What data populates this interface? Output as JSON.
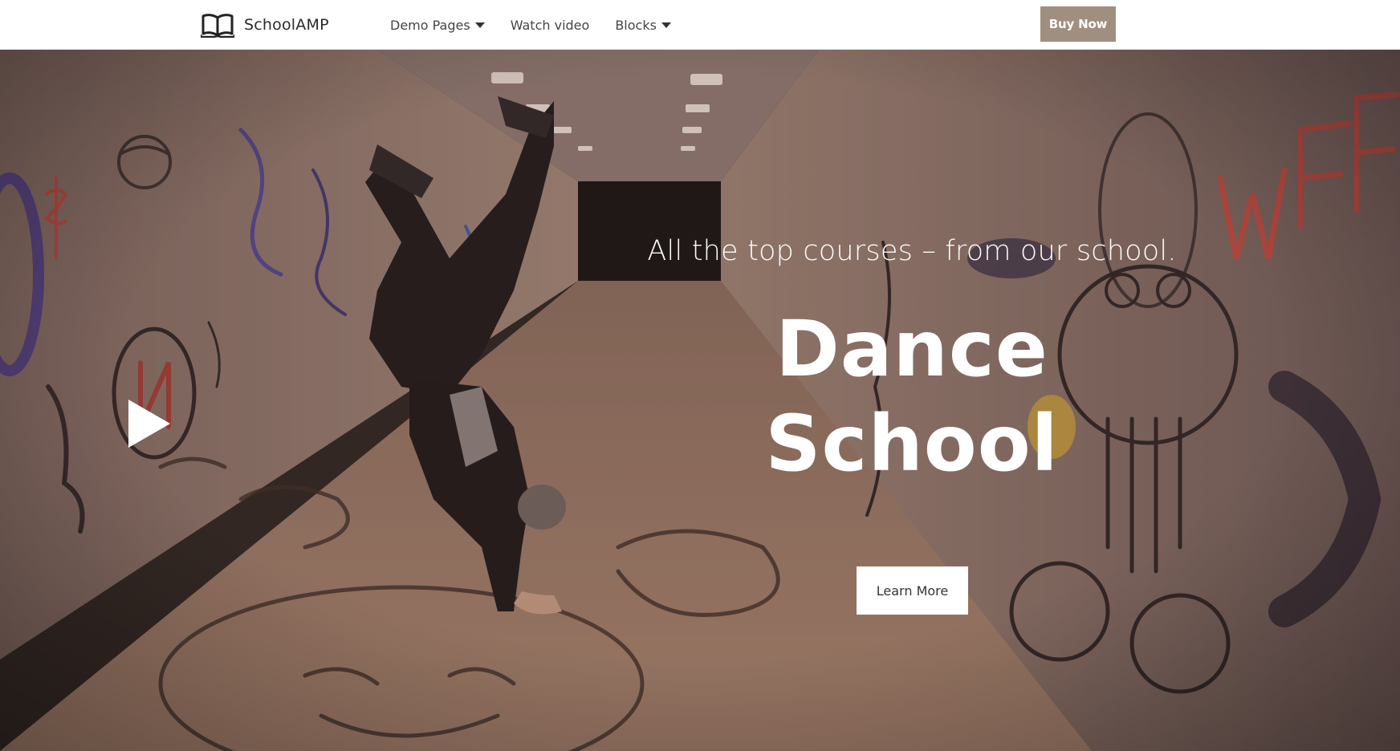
{
  "navbar": {
    "brand": {
      "name": "SchoolAMP",
      "icon": "open-book-icon"
    },
    "items": [
      {
        "label": "Demo Pages",
        "has_dropdown": true
      },
      {
        "label": "Watch video",
        "has_dropdown": false
      },
      {
        "label": "Blocks",
        "has_dropdown": true
      }
    ],
    "cta_label": "Buy Now"
  },
  "hero": {
    "subtitle": "All the top courses – from our school.",
    "title_line1": "Dance",
    "title_line2": "School",
    "button_label": "Learn More",
    "play_icon": "play-icon"
  },
  "colors": {
    "accent": "#a08f7f",
    "nav_text": "#454545",
    "hero_text": "#ffffff"
  }
}
